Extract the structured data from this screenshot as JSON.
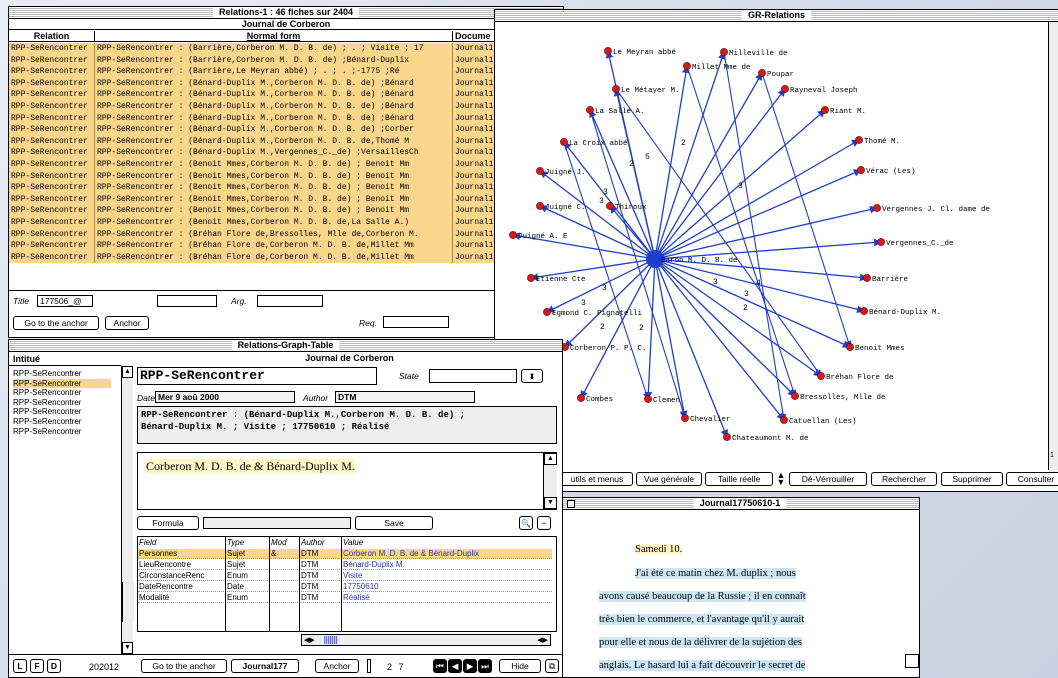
{
  "relations_window": {
    "title": "Relations-1 : 46 fiches sur 2404",
    "subtitle": "Journal de Corberon",
    "columns": [
      "Relation",
      "Normal form",
      "Docume"
    ],
    "rows": [
      [
        "RPP-SeRencontrer",
        "RPP-SeRencontrer : (Barrière,Corberon M. D. B. de) ; .  ; Visite ; 17",
        "Journal1"
      ],
      [
        "RPP-SeRencontrer",
        "RPP-SeRencontrer : (Barrière,Corberon M. D. B. de) ;Bénard-Duplix",
        "Journal1"
      ],
      [
        "RPP-SeRencontrer",
        "RPP-SeRencontrer : (Barrière,Le Meyran abbé) ; .  ; .  ;-1775 ;Ré",
        "Journal1"
      ],
      [
        "RPP-SeRencontrer",
        "RPP-SeRencontrer : (Bénard-Duplix M.,Corberon M. D. B. de) ;Bénard",
        "Journal1"
      ],
      [
        "RPP-SeRencontrer",
        "RPP-SeRencontrer : (Bénard-Duplix M.,Corberon M. D. B. de) ;Bénard",
        "Journal1"
      ],
      [
        "RPP-SeRencontrer",
        "RPP-SeRencontrer : (Bénard-Duplix M.,Corberon M. D. B. de) ;Bénard",
        "Journal1"
      ],
      [
        "RPP-SeRencontrer",
        "RPP-SeRencontrer : (Bénard-Duplix M.,Corberon M. D. B. de) ;Bénard",
        "Journal1"
      ],
      [
        "RPP-SeRencontrer",
        "RPP-SeRencontrer : (Bénard-Duplix M.,Corberon M. D. B. de) ;Corber",
        "Journal1"
      ],
      [
        "RPP-SeRencontrer",
        "RPP-SeRencontrer : (Bénard-Duplix M.,Corberon M. D. B. de,Thomé M",
        "Journal1"
      ],
      [
        "RPP-SeRencontrer",
        "RPP-SeRencontrer : (Bénard-Duplix M.,Vergennes_C._de) ;VersaillesCh",
        "Journal1"
      ],
      [
        "RPP-SeRencontrer",
        "RPP-SeRencontrer : (Benoit Mmes,Corberon M. D. B. de) ; Benoit Mm",
        "Journal1"
      ],
      [
        "RPP-SeRencontrer",
        "RPP-SeRencontrer : (Benoit Mmes,Corberon M. D. B. de) ; Benoit Mm",
        "Journal1"
      ],
      [
        "RPP-SeRencontrer",
        "RPP-SeRencontrer : (Benoit Mmes,Corberon M. D. B. de) ; Benoit Mm",
        "Journal1"
      ],
      [
        "RPP-SeRencontrer",
        "RPP-SeRencontrer : (Benoit Mmes,Corberon M. D. B. de) ; Benoit Mm",
        "Journal1"
      ],
      [
        "RPP-SeRencontrer",
        "RPP-SeRencontrer : (Benoit Mmes,Corberon M. D. B. de) ; Benoit Mm",
        "Journal1"
      ],
      [
        "RPP-SeRencontrer",
        "RPP-SeRencontrer : (Benoit Mmes,Corberon M. D. B. de,La Salle A.)",
        "Journal1"
      ],
      [
        "RPP-SeRencontrer",
        "RPP-SeRencontrer : (Bréhan Flore de,Bressolles, Mlle de,Corberon M.",
        "Journal1"
      ],
      [
        "RPP-SeRencontrer",
        "RPP-SeRencontrer : (Bréhan Flore de,Corberon M. D. B. de,Millet Mm",
        "Journal1"
      ],
      [
        "RPP-SeRencontrer",
        "RPP-SeRencontrer : (Bréhan Flore de,Corberon M. D. B. de,Millet Mm",
        "Journal1"
      ]
    ],
    "title_label": "Title",
    "title_value": "177506_@",
    "arg_label": "Arg.",
    "req_label": "Req.",
    "goto_label": "Go to the anchor",
    "anchor_label": "Anchor"
  },
  "graph_window": {
    "title": "GR-Relations",
    "center": "Baron M. D. B. de",
    "nodes": [
      "Le Meyran abbé",
      "Milleville de",
      "Millet Mme de",
      "Poupar",
      "Le Métayer M.",
      "Rayneval Joseph",
      "La Salle A.",
      "Riant M.",
      "La Croix abbé",
      "Thomé M.",
      "Juigné J.",
      "Vérac (Les)",
      "Juigné C.",
      "Thiroux",
      "Vergennes J. Cl. dame de",
      "Juigné A. E",
      "Vergennes_C._de",
      "Etienne Cte",
      "Barrière",
      "Egmond C. Pignatelli",
      "Bénard-Duplix M.",
      "Corberon P. P. C.",
      "Benoit Mmes",
      "Combes",
      "Bréhan Flore de",
      "Clemen",
      "Bressolles, Mlle de",
      "Chevalier",
      "Catuellan (Les)",
      "Chateaumont M. de"
    ],
    "edge_labels": [
      "2",
      "5",
      "3",
      "3",
      "2",
      "3",
      "3",
      "3",
      "2",
      "2",
      "4",
      "3",
      "2",
      "3"
    ],
    "toolbar": [
      "utils et menus",
      "Vue générale",
      "Taille réelle",
      "Dé-Vérrouiller",
      "Rechercher",
      "Supprimer",
      "Consulter"
    ],
    "scroll_value": "1"
  },
  "table_window": {
    "title": "Relations-Graph-Table",
    "subtitle": "Journal de Corberon",
    "list_header": "Intitué",
    "list_items": [
      "RPP-SeRencontrer",
      "RPP-SeRencontrer",
      "RPP-SeRencontrer",
      "RPP-SeRencontrer",
      "RPP-SeRencontrer",
      "RPP-SeRencontrer",
      "RPP-SeRencontrer"
    ],
    "name": "RPP-SeRencontrer",
    "state_label": "State",
    "date_label": "Date",
    "date_value": "Mer 9 aoû 2000",
    "author_label": "Author",
    "author_value": "DTM",
    "normal_line1": "RPP-SeRencontrer : (Bénard-Duplix M.,Corberon M. D. B. de) ;",
    "normal_line2": "Bénard-Duplix M. ; Visite  ; 17750610 ; Réalisé",
    "text_value": "Corberon M. D. B. de & Bénard-Duplix M.",
    "formula_label": "Formula",
    "save_label": "Save",
    "grid_headers": [
      "Field",
      "Type",
      "Mod",
      "Author",
      "Value"
    ],
    "grid_rows": [
      [
        "Personnes",
        "Sujet",
        "&",
        "DTM",
        "Corberon M. D. B. de & Bénard-Duplix"
      ],
      [
        "LieuRencontre",
        "Sujet",
        "",
        "DTM",
        "Bénard-Duplix M."
      ],
      [
        "CirconstanceRenc",
        "Enum",
        "",
        "DTM",
        "Visite"
      ],
      [
        "DateRencontre",
        "Date",
        "",
        "DTM",
        "17750610"
      ],
      [
        "Modalité",
        "Enum",
        "",
        "DTM",
        "Réalisé"
      ]
    ],
    "bottom": {
      "l": "L",
      "f": "F",
      "d": "D",
      "count": "202012",
      "goto": "Go to the anchor",
      "journal": "Journal177",
      "anchor": "Anchor",
      "page": "2 7",
      "hide": "Hide"
    }
  },
  "doc_window": {
    "title": "Journal17750610-1",
    "heading": "Samedi 10.",
    "lines": [
      "J'ai été ce matin chez M. duplix ; nous",
      "avons causé beaucoup de la Russie ; il en connaît",
      "très bien le commerce, et l'avantage qu'il y aurait",
      "pour elle et nous de la délivrer de la sujétion des",
      "anglais. Le hasard lui a fait découvrir le secret de"
    ]
  },
  "colors": {
    "row_highlight": "#fad68c",
    "node": "#d11a1a",
    "edge": "#1f3fc9",
    "value_text": "#2634b5",
    "doc_highlight": "#cce6f5"
  }
}
